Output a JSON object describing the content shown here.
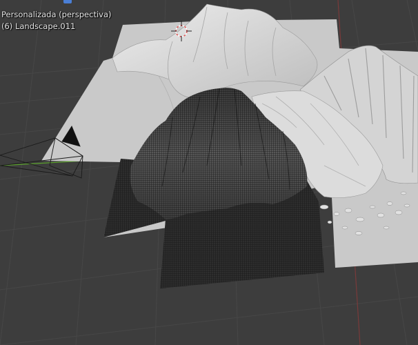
{
  "viewport": {
    "view_mode": "Personalizada (perspectiva)",
    "active_object": "(6) Landscape.011"
  },
  "scene": {
    "objects": [
      {
        "name": "landscape-solid-terrain",
        "shading": "solid"
      },
      {
        "name": "landscape-wireframe-terrain",
        "shading": "wireframe"
      },
      {
        "name": "landscape-rocky-terrain",
        "shading": "solid"
      },
      {
        "name": "camera",
        "type": "camera"
      },
      {
        "name": "3d-cursor",
        "type": "cursor"
      }
    ]
  },
  "colors": {
    "background": "#3d3d3d",
    "grid": "#4a4a4a",
    "x_axis": "#7a3a3a",
    "y_axis": "#5aa02c",
    "terrain": "#c9c9c9",
    "wire": "#1c1c1c",
    "header_icon": "#4a7fd6"
  }
}
